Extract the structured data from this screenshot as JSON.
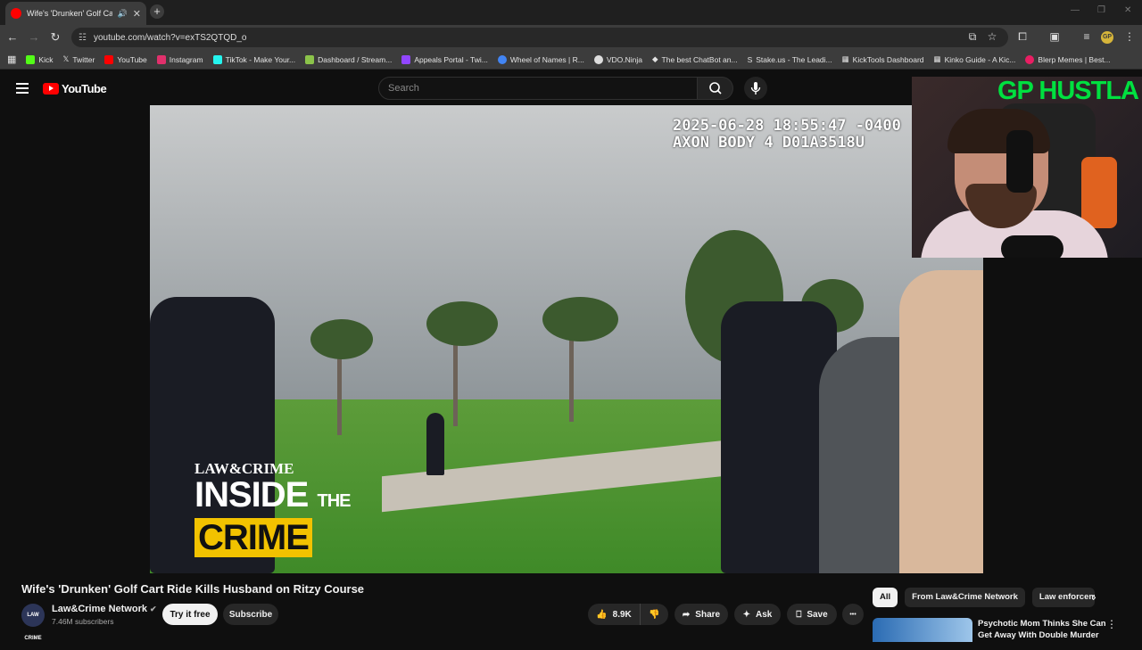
{
  "browser": {
    "tab_title": "Wife's 'Drunken' Golf Cart R",
    "new_tab": "+",
    "url": "youtube.com/watch?v=exTS2QTQD_o",
    "bookmarks": [
      {
        "label": "Kick",
        "color": "#53fc18"
      },
      {
        "label": "Twitter",
        "color": "#ffffff"
      },
      {
        "label": "YouTube",
        "color": "#ff0000"
      },
      {
        "label": "Instagram",
        "color": "#e1306c"
      },
      {
        "label": "TikTok - Make Your...",
        "color": "#25f4ee"
      },
      {
        "label": "Dashboard / Stream...",
        "color": "#8bc34a"
      },
      {
        "label": "Appeals Portal - Twi...",
        "color": "#9146ff"
      },
      {
        "label": "Wheel of Names | R...",
        "color": "#4285f4"
      },
      {
        "label": "VDO.Ninja",
        "color": "#dddddd"
      },
      {
        "label": "The best ChatBot an...",
        "color": "#cccccc"
      },
      {
        "label": "Stake.us - The Leadi...",
        "color": "#bbbbbb"
      },
      {
        "label": "KickTools Dashboard",
        "color": "#eeeeee"
      },
      {
        "label": "Kinko Guide - A Kic...",
        "color": "#eeeeee"
      },
      {
        "label": "Blerp Memes | Best...",
        "color": "#e91e63"
      }
    ],
    "profile": "GP"
  },
  "youtube": {
    "logo_text": "YouTube",
    "search_placeholder": "Search"
  },
  "video": {
    "timestamp_line1": "2025-06-28 18:55:47 -0400",
    "timestamp_line2": "AXON BODY 4 D01A3518U",
    "brand_line1": "LAW&CRIME",
    "brand_line2": "INSIDE",
    "brand_the": "THE",
    "brand_line3": "CRIME",
    "overlay_text": "GP HUSTLA"
  },
  "meta": {
    "title": "Wife's 'Drunken' Golf Cart Ride Kills Husband on Ritzy Course",
    "channel": "Law&Crime Network",
    "subscribers": "7.46M subscribers",
    "avatar_text": "LAW CRIME",
    "try_it_free": "Try it free",
    "subscribe": "Subscribe",
    "likes": "8.9K",
    "share": "Share",
    "ask": "Ask",
    "save": "Save",
    "more": "•••"
  },
  "chips": [
    "All",
    "From Law&Crime Network",
    "Law enforcem"
  ],
  "recommendation": {
    "title": "Psychotic Mom Thinks She Can Get Away With Double Murder"
  }
}
